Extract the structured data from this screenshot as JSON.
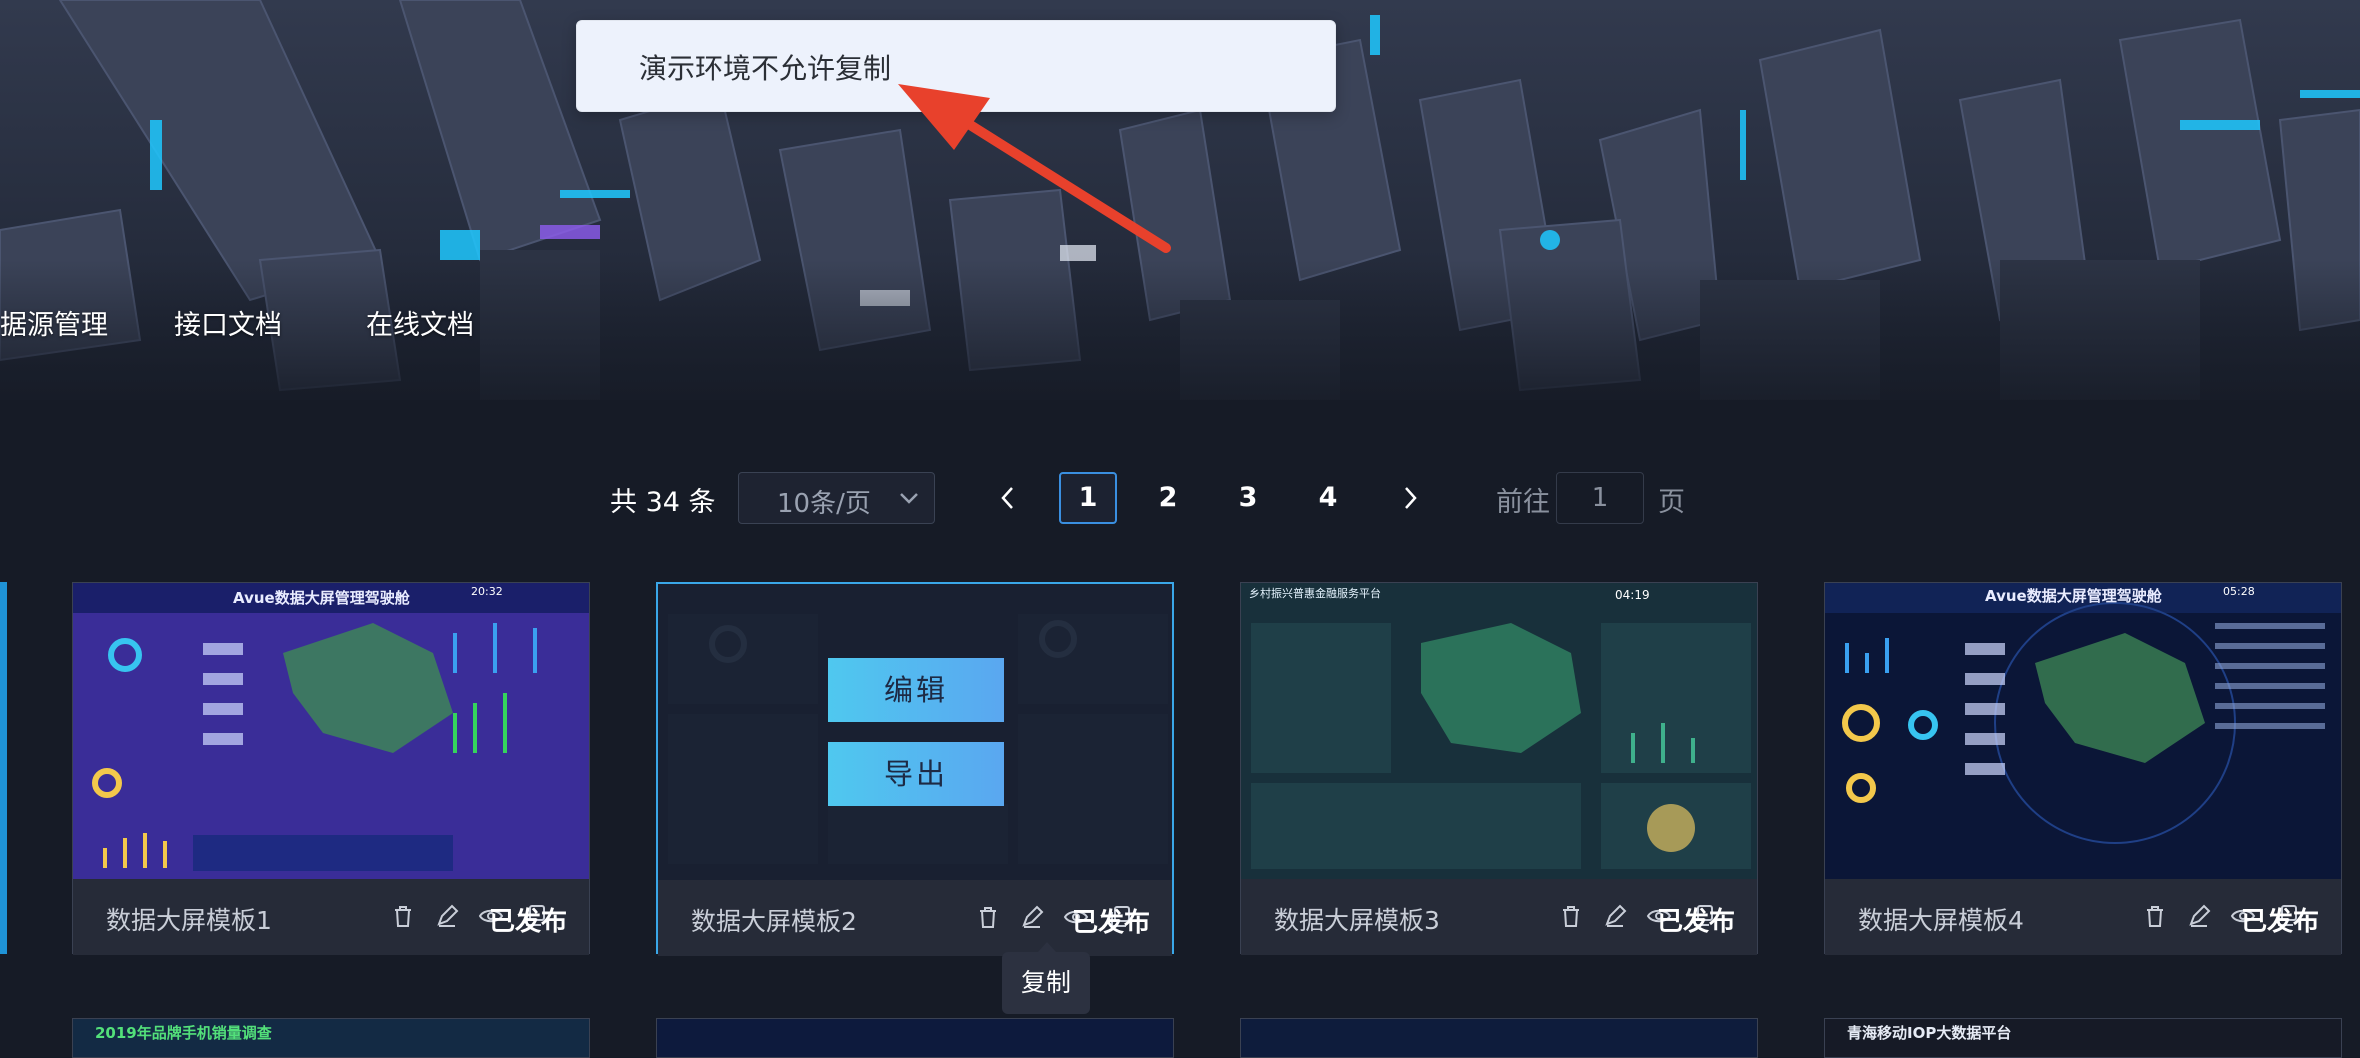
{
  "nav": {
    "items": [
      "据源管理",
      "接口文档",
      "在线文档"
    ]
  },
  "toast": {
    "message": "演示环境不允许复制"
  },
  "pagination": {
    "total": "共 34 条",
    "page_size": "10条/页",
    "pages": [
      "1",
      "2",
      "3",
      "4"
    ],
    "current_page": 1,
    "goto_prefix": "前往",
    "goto_value": "1",
    "goto_suffix": "页"
  },
  "cards": [
    {
      "name": "数据大屏模板1",
      "status": "已发布",
      "thumb_title": "Avue数据大屏管理驾驶舱",
      "thumb_time": "20:32"
    },
    {
      "name": "数据大屏模板2",
      "status": "已发布"
    },
    {
      "name": "数据大屏模板3",
      "status": "已发布",
      "thumb_title": "乡村振兴普惠金融服务平台",
      "thumb_time": "04:19"
    },
    {
      "name": "数据大屏模板4",
      "status": "已发布",
      "thumb_title": "Avue数据大屏管理驾驶舱",
      "thumb_time": "05:28"
    }
  ],
  "hover_actions": {
    "edit": "编辑",
    "export": "导出"
  },
  "tooltip": {
    "text": "复制"
  },
  "next_row": [
    {
      "thumb_title": "2019年品牌手机销量调查"
    },
    {
      "thumb_title": ""
    },
    {
      "thumb_title": ""
    },
    {
      "thumb_title": "青海移动IOP大数据平台"
    }
  ],
  "colors": {
    "accent": "#3aa7e8",
    "toast_bg": "#edf2fc",
    "arrow": "#e8412c"
  }
}
